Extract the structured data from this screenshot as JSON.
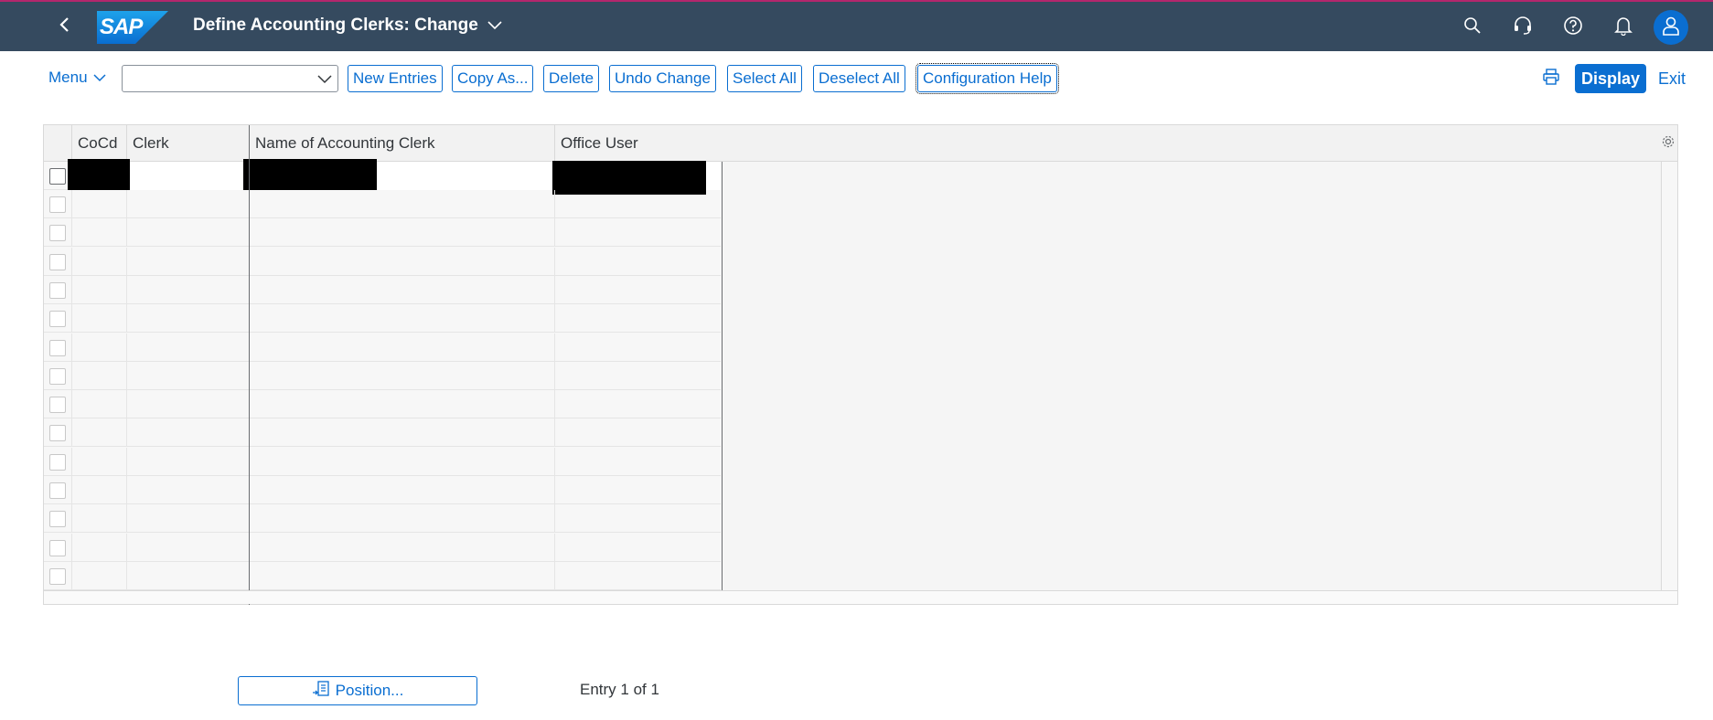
{
  "shell": {
    "logo_text": "SAP",
    "title": "Define Accounting Clerks: Change",
    "icons": [
      "back-icon",
      "search-icon",
      "support-icon",
      "help-icon",
      "bell-icon",
      "user-icon"
    ]
  },
  "toolbar": {
    "menu_label": "Menu",
    "select_value": "",
    "buttons": [
      "New Entries",
      "Copy As...",
      "Delete",
      "Undo Change",
      "Select All",
      "Deselect All",
      "Configuration Help"
    ],
    "display_label": "Display",
    "exit_label": "Exit"
  },
  "table": {
    "columns": [
      "CoCd",
      "Clerk",
      "Name of Accounting Clerk",
      "Office User"
    ],
    "rows": [
      {
        "cocd": "",
        "clerk": "",
        "name": "",
        "office_user": "",
        "redacted": true
      }
    ],
    "empty_rows": 14
  },
  "footer": {
    "position_label": "Position...",
    "entry_info": "Entry 1 of 1"
  },
  "colors": {
    "shell_bg": "#354a5f",
    "accent": "#0a6ed1",
    "shell_top_border": "#b4276d"
  }
}
